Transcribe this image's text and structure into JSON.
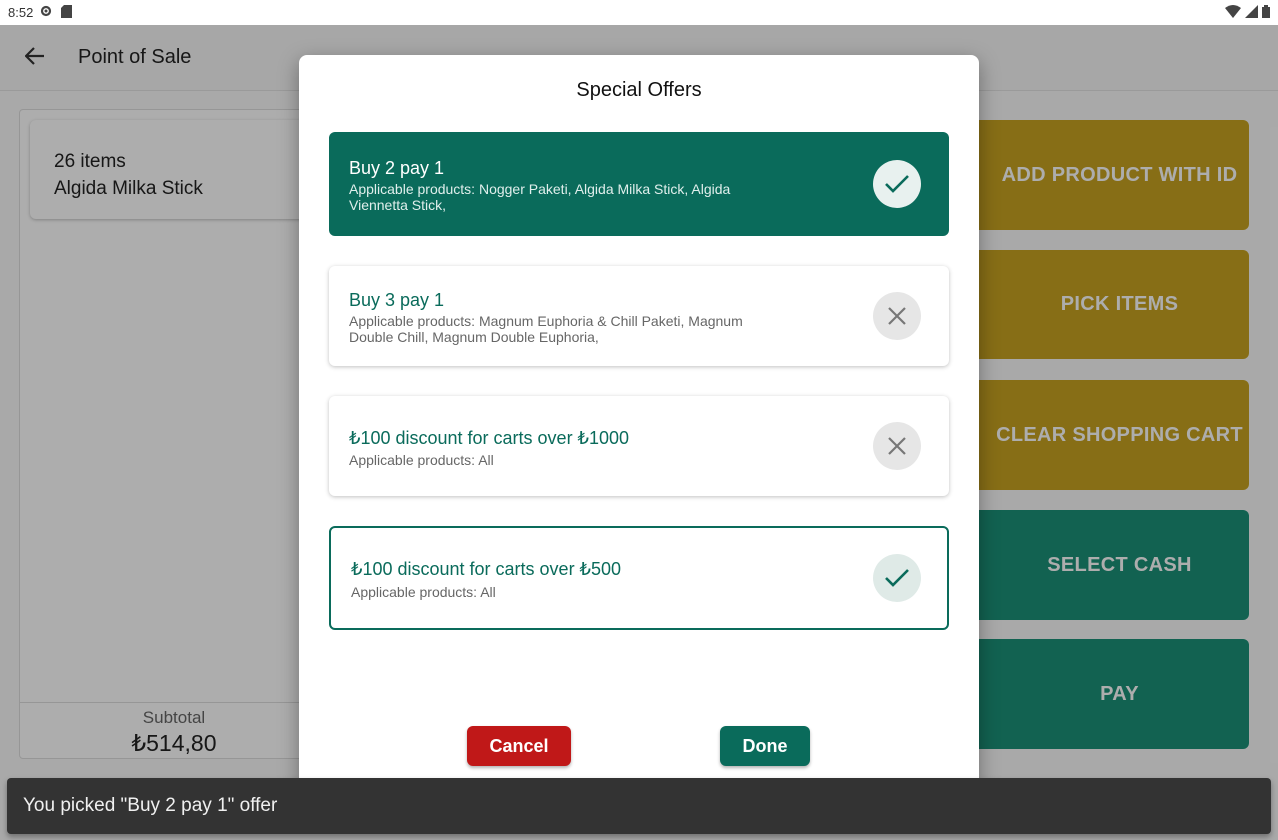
{
  "status_bar": {
    "time": "8:52",
    "icons": [
      "settings-icon",
      "sd-card-icon",
      "wifi-icon",
      "signal-icon",
      "battery-icon"
    ]
  },
  "app_bar": {
    "back_icon": "arrow-left-icon",
    "title": "Point of Sale"
  },
  "cart": {
    "item_count": "26 items",
    "item_name": "Algida Milka Stick",
    "subtotal_label": "Subtotal",
    "subtotal_value": "₺514,80"
  },
  "actions": [
    {
      "label": "ADD PRODUCT WITH ID",
      "color": "#c8a321"
    },
    {
      "label": "PICK ITEMS",
      "color": "#c8a321"
    },
    {
      "label": "CLEAR SHOPPING CART",
      "color": "#c8a321"
    },
    {
      "label": "SELECT CASH",
      "color": "#1b9178"
    },
    {
      "label": "PAY",
      "color": "#1b9178"
    }
  ],
  "dialog": {
    "title": "Special Offers",
    "offers": [
      {
        "title": "Buy 2 pay 1",
        "products": "Applicable products: Nogger Paketi, Algida Milka Stick, Algida Viennetta Stick,",
        "state": "selected",
        "icon": "check-icon"
      },
      {
        "title": "Buy 3 pay 1",
        "products": "Applicable products: Magnum Euphoria & Chill Paketi, Magnum Double Chill, Magnum Double Euphoria,",
        "state": "unselected",
        "icon": "close-icon"
      },
      {
        "title": "₺100 discount for carts over ₺1000",
        "products": "Applicable products: All",
        "state": "unselected",
        "icon": "close-icon"
      },
      {
        "title": "₺100 discount for carts over ₺500",
        "products": "Applicable products: All",
        "state": "selected-outlined",
        "icon": "check-icon"
      }
    ],
    "cancel_label": "Cancel",
    "done_label": "Done"
  },
  "snackbar": {
    "message": "You picked \"Buy 2 pay 1\" offer"
  },
  "colors": {
    "primary": "#0a6b5b",
    "accent_gold": "#c8a321",
    "cancel_red": "#c01818"
  }
}
